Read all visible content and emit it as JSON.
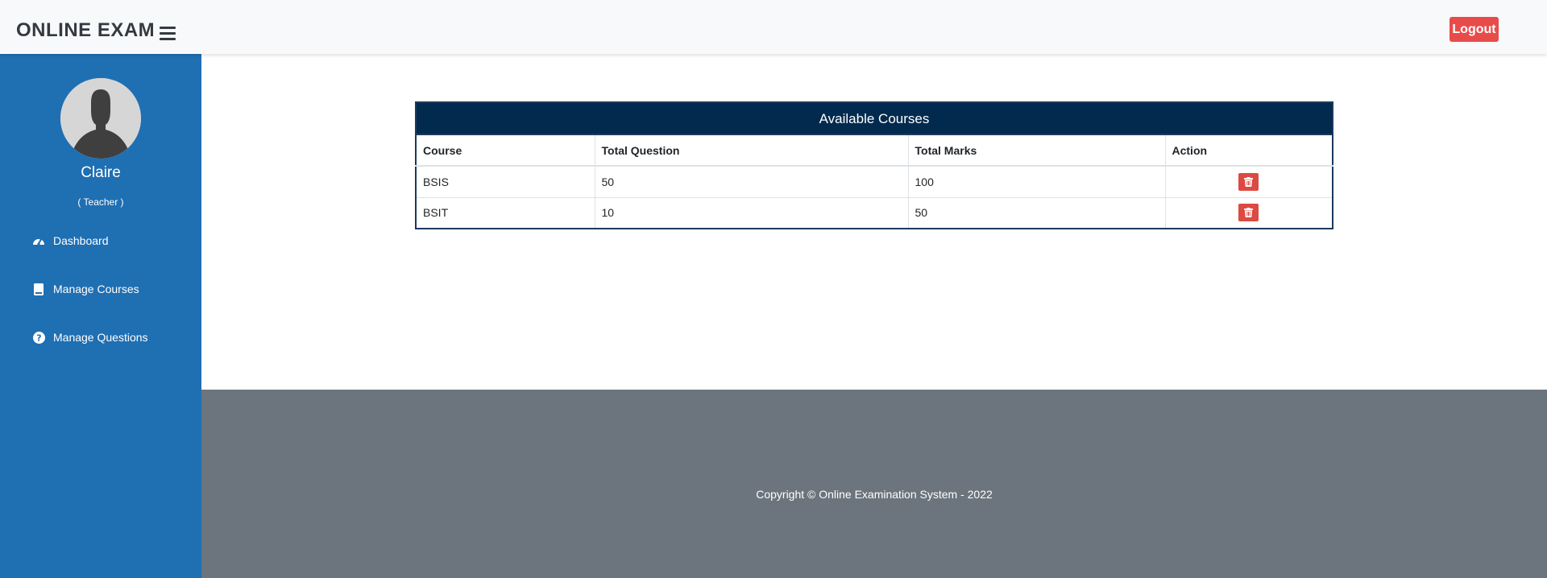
{
  "header": {
    "brand": "ONLINE EXAM",
    "logout_label": "Logout"
  },
  "sidebar": {
    "user_name": "Claire",
    "user_role": "( Teacher )",
    "items": [
      {
        "label": "Dashboard",
        "icon": "tachometer-icon"
      },
      {
        "label": "Manage Courses",
        "icon": "book-icon"
      },
      {
        "label": "Manage Questions",
        "icon": "question-circle-icon"
      }
    ]
  },
  "main": {
    "table_title": "Available Courses",
    "columns": [
      "Course",
      "Total Question",
      "Total Marks",
      "Action"
    ],
    "rows": [
      {
        "course": "BSIS",
        "total_question": "50",
        "total_marks": "100"
      },
      {
        "course": "BSIT",
        "total_question": "10",
        "total_marks": "50"
      }
    ]
  },
  "footer": {
    "text": "Copyright © Online Examination System - 2022"
  },
  "colors": {
    "sidebar": "#1f6fb3",
    "table_header": "#022a4e",
    "logout": "#e84c4a",
    "delete": "#dc4a42",
    "footer": "#6c757d"
  }
}
